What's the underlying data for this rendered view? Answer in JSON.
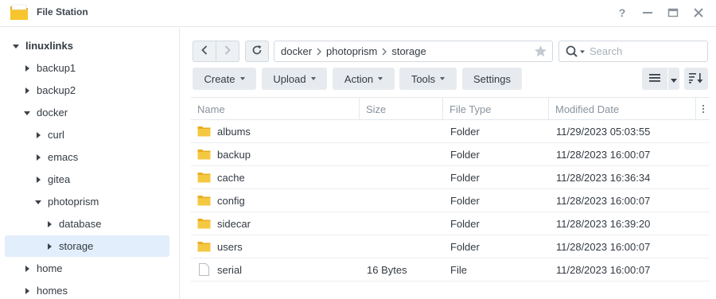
{
  "window": {
    "title": "File Station",
    "buttons": [
      "help",
      "minimize",
      "maximize",
      "close"
    ]
  },
  "colors": {
    "folder": "#f5c842",
    "selection": "#e2eefb",
    "button_bg": "#e7ebef",
    "text": "#333a42",
    "muted_text": "#8a939d"
  },
  "sidebar": {
    "items": [
      {
        "label": "linuxlinks",
        "depth": 0,
        "state": "expanded",
        "root": true,
        "selected": false
      },
      {
        "label": "backup1",
        "depth": 1,
        "state": "collapsed",
        "root": false,
        "selected": false
      },
      {
        "label": "backup2",
        "depth": 1,
        "state": "collapsed",
        "root": false,
        "selected": false
      },
      {
        "label": "docker",
        "depth": 1,
        "state": "expanded",
        "root": false,
        "selected": false
      },
      {
        "label": "curl",
        "depth": 2,
        "state": "collapsed",
        "root": false,
        "selected": false
      },
      {
        "label": "emacs",
        "depth": 2,
        "state": "collapsed",
        "root": false,
        "selected": false
      },
      {
        "label": "gitea",
        "depth": 2,
        "state": "collapsed",
        "root": false,
        "selected": false
      },
      {
        "label": "photoprism",
        "depth": 2,
        "state": "expanded",
        "root": false,
        "selected": false
      },
      {
        "label": "database",
        "depth": 3,
        "state": "collapsed",
        "root": false,
        "selected": false
      },
      {
        "label": "storage",
        "depth": 3,
        "state": "collapsed",
        "root": false,
        "selected": true
      },
      {
        "label": "home",
        "depth": 1,
        "state": "collapsed",
        "root": false,
        "selected": false
      },
      {
        "label": "homes",
        "depth": 1,
        "state": "collapsed",
        "root": false,
        "selected": false
      }
    ]
  },
  "navigation": {
    "back_icon": "chevron-left-icon",
    "forward_icon": "chevron-right-icon",
    "refresh_icon": "refresh-icon",
    "breadcrumb": [
      "docker",
      "photoprism",
      "storage"
    ],
    "favorite_icon": "star-icon"
  },
  "search": {
    "placeholder": "Search",
    "value": ""
  },
  "toolbar": {
    "create_label": "Create",
    "upload_label": "Upload",
    "action_label": "Action",
    "tools_label": "Tools",
    "settings_label": "Settings"
  },
  "table": {
    "columns": [
      "Name",
      "Size",
      "File Type",
      "Modified Date"
    ],
    "rows": [
      {
        "icon": "folder",
        "name": "albums",
        "size": "",
        "type": "Folder",
        "modified": "11/29/2023 05:03:55"
      },
      {
        "icon": "folder",
        "name": "backup",
        "size": "",
        "type": "Folder",
        "modified": "11/28/2023 16:00:07"
      },
      {
        "icon": "folder",
        "name": "cache",
        "size": "",
        "type": "Folder",
        "modified": "11/28/2023 16:36:34"
      },
      {
        "icon": "folder",
        "name": "config",
        "size": "",
        "type": "Folder",
        "modified": "11/28/2023 16:00:07"
      },
      {
        "icon": "folder",
        "name": "sidecar",
        "size": "",
        "type": "Folder",
        "modified": "11/28/2023 16:39:20"
      },
      {
        "icon": "folder",
        "name": "users",
        "size": "",
        "type": "Folder",
        "modified": "11/28/2023 16:00:07"
      },
      {
        "icon": "file",
        "name": "serial",
        "size": "16 Bytes",
        "type": "File",
        "modified": "11/28/2023 16:00:07"
      }
    ]
  }
}
